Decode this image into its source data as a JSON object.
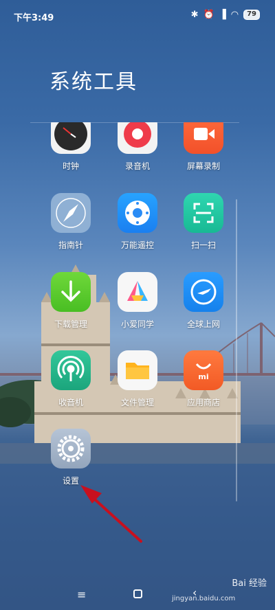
{
  "status_bar": {
    "time": "下午3:49",
    "battery": "79"
  },
  "folder": {
    "title": "系统工具"
  },
  "apps": [
    {
      "label": "时钟",
      "icon": "clock-icon"
    },
    {
      "label": "录音机",
      "icon": "recorder-icon"
    },
    {
      "label": "屏幕录制",
      "icon": "screen-record-icon"
    },
    {
      "label": "指南针",
      "icon": "compass-icon"
    },
    {
      "label": "万能遥控",
      "icon": "remote-icon"
    },
    {
      "label": "扫一扫",
      "icon": "scan-icon"
    },
    {
      "label": "下载管理",
      "icon": "download-icon"
    },
    {
      "label": "小爱同学",
      "icon": "xiaoai-icon"
    },
    {
      "label": "全球上网",
      "icon": "global-internet-icon"
    },
    {
      "label": "收音机",
      "icon": "radio-icon"
    },
    {
      "label": "文件管理",
      "icon": "file-manager-icon"
    },
    {
      "label": "应用商店",
      "icon": "app-store-icon"
    },
    {
      "label": "设置",
      "icon": "settings-icon"
    }
  ],
  "watermark": {
    "brand": "Bai 经验",
    "url": "jingyan.baidu.com"
  },
  "colors": {
    "annotation_arrow": "#c8101e"
  }
}
